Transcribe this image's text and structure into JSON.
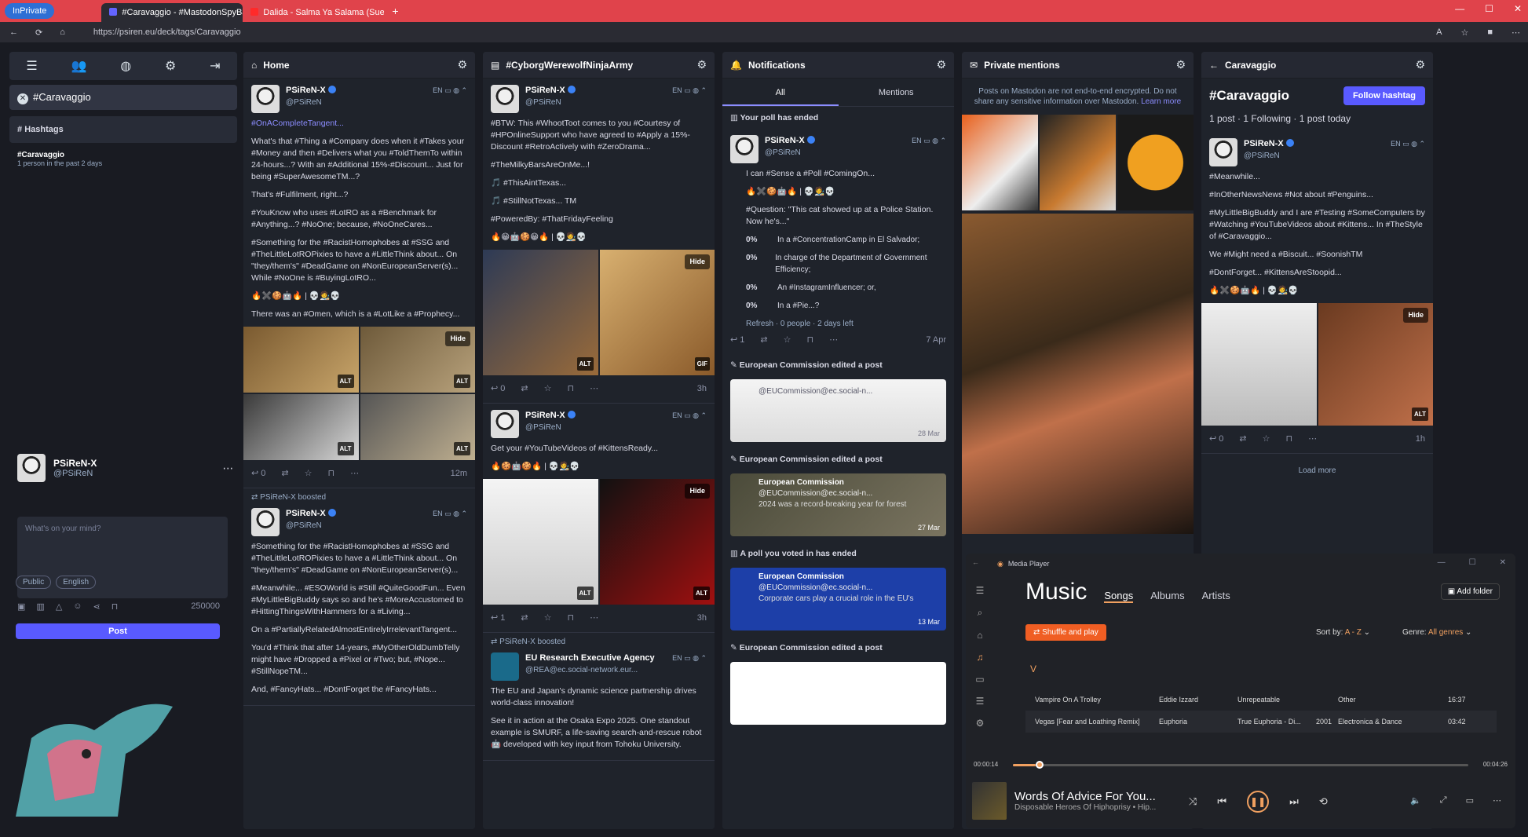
{
  "browser": {
    "inprivate": "InPrivate",
    "tabs": [
      "#Caravaggio - #MastodonSpyBall...",
      "Dalida - Salma Ya Salama (Suefio..."
    ],
    "url": "https://psiren.eu/deck/tags/Caravaggio"
  },
  "nav": {
    "hashtag_chip": "#Caravaggio",
    "hashtags_title": "Hashtags",
    "tag_name": "#Caravaggio",
    "tag_stat": "1 person in the past 2 days",
    "me_name": "PSiReN-X",
    "me_handle": "@PSiReN",
    "compose_placeholder": "What's on your mind?",
    "visibility": "Public",
    "language": "English",
    "char_count": "250000",
    "post_label": "Post"
  },
  "home": {
    "title": "Home",
    "post1": {
      "name": "PSiReN-X",
      "handle": "@PSiReN",
      "lang": "EN",
      "paras": [
        "#OnACompleteTangent...",
        "What's that #Thing a #Company does when it #Takes your #Money and then #Delivers what you #ToldThemTo within 24-hours...? With an #Additional 15%-#Discount... Just for being #SuperAwesomeTM...?",
        "That's #Fulfilment, right...?",
        "#YouKnow who uses #LotRO as a #Benchmark for #Anything...? #NoOne; because, #NoOneCares...",
        "#Something for the #RacistHomophobes at #SSG and #TheLittleLotROPixies to have a #LittleThink about... On \"they/them's\" #DeadGame on #NonEuropeanServer(s)... While #NoOne is #BuyingLotRO...",
        "🔥✖️🍪🤖🔥 | 💀🧑‍🎨💀",
        "There was an #Omen, which is a #LotLike a #Prophecy..."
      ],
      "time": "12m",
      "replies": "0"
    },
    "boost_label": "PSiReN-X boosted",
    "post2": {
      "name": "PSiReN-X",
      "handle": "@PSiReN",
      "lang": "EN",
      "paras": [
        "#Something for the #RacistHomophobes at #SSG and #TheLittleLotROPixies to have a #LittleThink about... On \"they/them's\" #DeadGame on #NonEuropeanServer(s)...",
        "#Meanwhile... #ESOWorld is #Still #QuiteGoodFun... Even #MyLittleBigBuddy says so and he's #MoreAccustomed to #HittingThingsWithHammers for a #Living...",
        "On a #PartiallyRelatedAlmostEntirelyIrrelevantTangent...",
        "You'd #Think that after 14-years, #MyOtherOldDumbTelly might have #Dropped a #Pixel or #Two; but, #Nope... #StillNopeTM...",
        "And, #FancyHats... #DontForget the #FancyHats..."
      ]
    }
  },
  "cyborg": {
    "title": "#CyborgWerewolfNinjaArmy",
    "post1": {
      "name": "PSiReN-X",
      "handle": "@PSiReN",
      "lang": "EN",
      "paras": [
        "#BTW: This #WhootToot comes to you #Courtesy of #HPOnlineSupport who have agreed to #Apply a 15%-Discount #RetroActively with #ZeroDrama...",
        "#TheMilkyBarsAreOnMe...!",
        "🎵 #ThisAintTexas...",
        "🎵 #StillNotTexas... TM",
        "#PoweredBy: #ThatFridayFeeling",
        "🔥😁🤖🍪😁🔥 | 💀🧑‍🎨💀"
      ],
      "time": "3h",
      "replies": "0"
    },
    "post2": {
      "name": "PSiReN-X",
      "handle": "@PSiReN",
      "lang": "EN",
      "paras": [
        "Get your #YouTubeVideos of #KittensReady...",
        "🔥🍪🤖🍪🔥 | 💀🧑‍🎨💀"
      ],
      "time": "3h",
      "replies": "1"
    },
    "boost_label": "PSiReN-X boosted",
    "post3": {
      "name": "EU Research Executive Agency",
      "handle": "@REA@ec.social-network.eur...",
      "lang": "EN",
      "paras": [
        "The EU and Japan's dynamic science partnership drives world-class innovation!",
        "See it in action at the Osaka Expo 2025. One standout example is SMURF, a life-saving search-and-rescue robot 🤖 developed with key input from Tohoku University."
      ]
    }
  },
  "notifications": {
    "title": "Notifications",
    "tab_all": "All",
    "tab_mentions": "Mentions",
    "poll_ended": "Your poll has ended",
    "poll_post": {
      "name": "PSiReN-X",
      "handle": "@PSiReN",
      "lang": "EN",
      "text": "I can #Sense a #Poll #ComingOn...",
      "question": "#Question: \"This cat showed up at a Police Station. Now he's...\"",
      "options": [
        {
          "pct": "0%",
          "label": "In a #ConcentrationCamp in El Salvador;"
        },
        {
          "pct": "0%",
          "label": "In charge of the Department of Government Efficiency;"
        },
        {
          "pct": "0%",
          "label": "An #InstagramInfluencer; or,"
        },
        {
          "pct": "0%",
          "label": "In a #Pie...?"
        }
      ],
      "footer": "Refresh · 0 people · 2 days left",
      "date": "7 Apr",
      "replies": "1"
    },
    "ec_edit1": "European Commission edited a post",
    "ec_edit1_handle": "@EUCommission@ec.social-n...",
    "ec_edit1_date": "28 Mar",
    "ec_edit2": "European Commission edited a post",
    "ec_edit2_name": "European Commission",
    "ec_edit2_handle": "@EUCommission@ec.social-n...",
    "ec_edit2_text": "2024 was a record-breaking year for forest",
    "ec_edit2_date": "27 Mar",
    "poll_voted": "A poll you voted in has ended",
    "ec_poll_name": "European Commission",
    "ec_poll_handle": "@EUCommission@ec.social-n...",
    "ec_poll_text": "Corporate cars play a crucial role in the EU's",
    "ec_poll_date": "13 Mar",
    "ec_edit3": "European Commission edited a post"
  },
  "private": {
    "title": "Private mentions",
    "note": "Posts on Mastodon are not end-to-end encrypted. Do not share any sensitive information over Mastodon.",
    "learn": "Learn more"
  },
  "caravaggio": {
    "title": "Caravaggio",
    "tag": "#Caravaggio",
    "follow": "Follow hashtag",
    "stats": "1 post · 1 Following · 1 post today",
    "post": {
      "name": "PSiReN-X",
      "handle": "@PSiReN",
      "lang": "EN",
      "paras": [
        "#Meanwhile...",
        "#InOtherNewsNews #Not about #Penguins...",
        "#MyLittleBigBuddy and I are #Testing #SomeComputers by #Watching #YouTubeVideos about #Kittens... In #TheStyle of #Caravaggio...",
        "We #Might need a #Biscuit... #SoonishTM",
        "#DontForget... #KittensAreStoopid...",
        "🔥✖️🍪🤖🔥 | 💀🧑‍🎨💀"
      ],
      "time": "1h",
      "replies": "0"
    },
    "load_more": "Load more"
  },
  "player": {
    "app": "Media Player",
    "heading": "Music",
    "tabs": [
      "Songs",
      "Albums",
      "Artists"
    ],
    "add_folder": "Add folder",
    "shuffle": "Shuffle and play",
    "sort_label": "Sort by:",
    "sort_value": "A - Z",
    "genre_label": "Genre:",
    "genre_value": "All genres",
    "letter": "V",
    "rows": [
      {
        "title": "Vampire On A Trolley",
        "artist": "Eddie Izzard",
        "album": "Unrepeatable",
        "year": "",
        "genre": "Other",
        "dur": "16:37"
      },
      {
        "title": "Vegas [Fear and Loathing Remix]",
        "artist": "Euphoria",
        "album": "True Euphoria - Di...",
        "year": "2001",
        "genre": "Electronica & Dance",
        "dur": "03:42"
      }
    ],
    "elapsed": "00:00:14",
    "total": "00:04:26",
    "progress": 0.05,
    "now_title": "Words Of Advice For You...",
    "now_artist": "Disposable Heroes Of Hiphoprisy • Hip..."
  },
  "colors": {
    "accent": "#595aff",
    "hashtag": "#8c8dff",
    "tabbar": "#e0434b",
    "player_accent": "#f0a060"
  }
}
